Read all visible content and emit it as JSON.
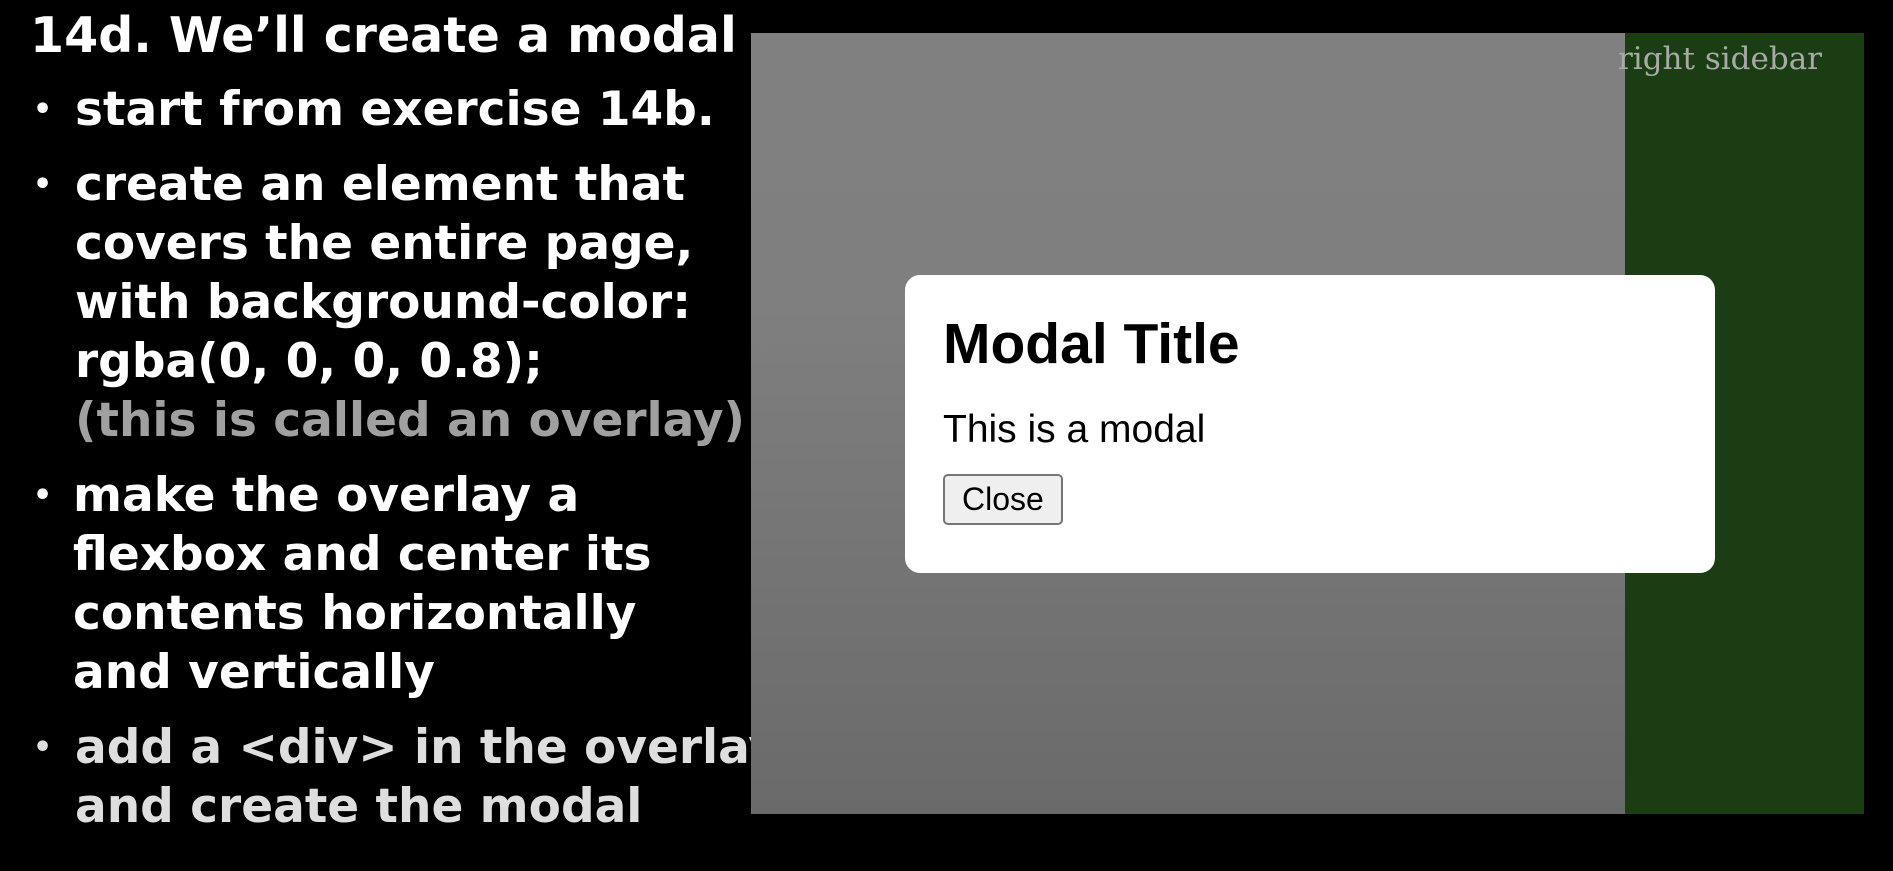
{
  "slide": {
    "title": "14d. We’ll create a modal",
    "bullet_symbol": "•",
    "bullets": [
      {
        "lines": [
          "start from exercise 14b."
        ]
      },
      {
        "lines": [
          "create an element that",
          "covers the entire page,",
          "with background-color:",
          "rgba(0, 0, 0, 0.8);"
        ],
        "note": "(this is called an overlay)"
      },
      {
        "lines": [
          "make the overlay a",
          "flexbox and center its",
          "contents horizontally",
          "and vertically"
        ]
      },
      {
        "lines": [
          "add a <div> in the overlay",
          "and create the modal"
        ]
      }
    ]
  },
  "demo": {
    "sidebar_label": "right sidebar",
    "modal": {
      "title": "Modal Title",
      "body": "This is a modal",
      "close_label": "Close"
    }
  },
  "colors": {
    "slide_background": "#000000",
    "slide_text": "#ffffff",
    "note_text": "#a0a0a0",
    "overlay_gray": "#7f7f7f",
    "sidebar_green": "#1b3d13",
    "modal_background": "#ffffff"
  }
}
